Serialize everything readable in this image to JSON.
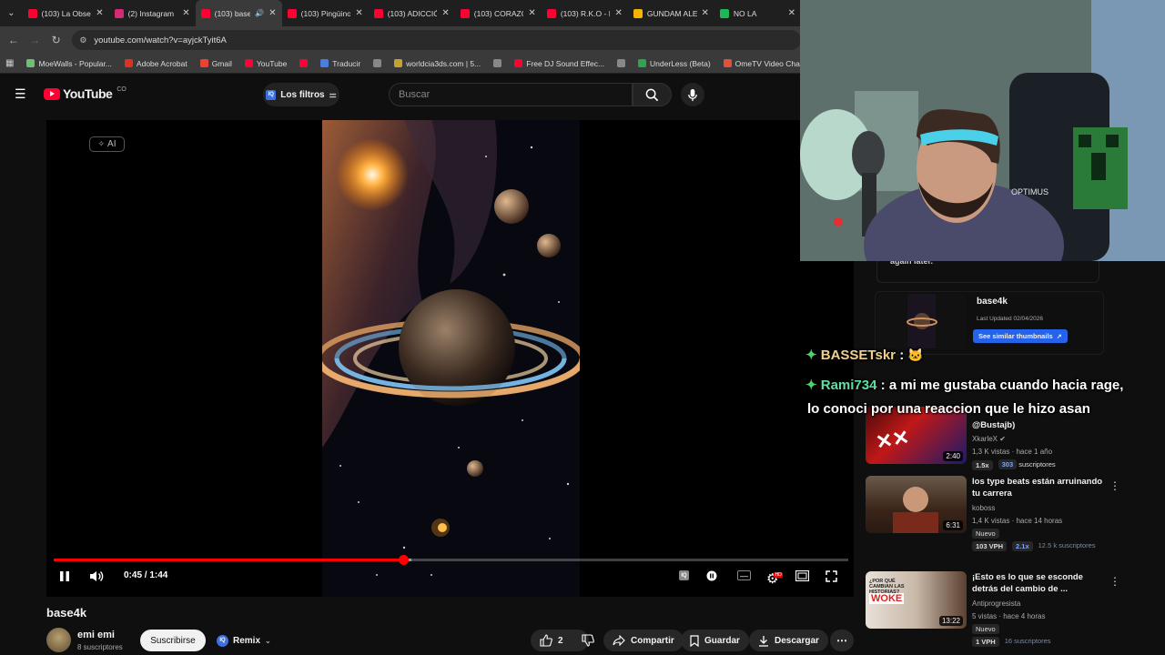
{
  "tabs": [
    {
      "title": "(103) La Obses",
      "fav": "youtube-icon",
      "color": "#ff0033"
    },
    {
      "title": "(2) Instagram",
      "fav": "instagram-icon",
      "color": "#d62976"
    },
    {
      "title": "(103) base4",
      "fav": "youtube-icon",
      "color": "#ff0033",
      "active": true
    },
    {
      "title": "(103) Pingüino",
      "fav": "youtube-icon",
      "color": "#ff0033"
    },
    {
      "title": "(103) ADICCIÓ",
      "fav": "youtube-icon",
      "color": "#ff0033"
    },
    {
      "title": "(103) CORAZÓ",
      "fav": "youtube-icon",
      "color": "#ff0033"
    },
    {
      "title": "(103) R.K.O - N",
      "fav": "youtube-icon",
      "color": "#ff0033"
    },
    {
      "title": "GUNDAM ALE",
      "fav": "drive-icon",
      "color": "#f4b400"
    },
    {
      "title": "NO LA",
      "fav": "spotify-icon",
      "color": "#1db954"
    }
  ],
  "url": "youtube.com/watch?v=ayjckTyit6A",
  "bookmarks": [
    {
      "label": "MoeWalls - Popular...",
      "color": "#6fbf73"
    },
    {
      "label": "Adobe Acrobat",
      "color": "#e0301e"
    },
    {
      "label": "Gmail",
      "color": "#ea4335"
    },
    {
      "label": "YouTube",
      "color": "#ff0033"
    },
    {
      "label": "",
      "color": "#ff0033"
    },
    {
      "label": "Traducir",
      "color": "#4a7fe0"
    },
    {
      "label": "",
      "color": "#888888"
    },
    {
      "label": "worldcia3ds.com | 5...",
      "color": "#c8a030"
    },
    {
      "label": "",
      "color": "#888888"
    },
    {
      "label": "Free DJ Sound Effec...",
      "color": "#ff0033"
    },
    {
      "label": "",
      "color": "#888888"
    },
    {
      "label": "UnderLess (Beta)",
      "color": "#2ea44f"
    },
    {
      "label": "OmeTV Video Chat...",
      "color": "#e0503a"
    }
  ],
  "yt": {
    "logo_word": "YouTube",
    "logo_country": "CO",
    "filters_label": "Los filtros",
    "search_placeholder": "Buscar"
  },
  "player": {
    "ai_badge": "AI",
    "time": "0:45 / 1:44",
    "progress": 0.44,
    "buffered": 0.45
  },
  "video": {
    "title": "base4k",
    "channel": "emi emi",
    "subscribers": "8 suscriptores",
    "subscribe_label": "Suscribirse",
    "remix_label": "Remix",
    "likes": "2",
    "share_label": "Compartir",
    "save_label": "Guardar",
    "download_label": "Descargar"
  },
  "sidebar": {
    "again_text": "again later.",
    "ext_title": "base4k",
    "ext_updated": "Last Updated 02/04/2026",
    "ext_button": "See similar thumbnails",
    "rec1": {
      "title_tail": "@Bustajb)",
      "channel": "XkarleX",
      "meta": "1,3 K vistas · hace 1 año",
      "dur": "2:40",
      "tag1": "1.5x",
      "tag2_a": "303",
      "tag2_b": "suscriptores"
    },
    "rec2": {
      "title": "los type beats están arruinando tu carrera",
      "channel": "koboss",
      "meta": "1,4 K vistas · hace 14 horas",
      "new": "Nuevo",
      "dur": "6:31",
      "tag1": "103 VPH",
      "tag2": "2.1x",
      "tag3": "12.5 k suscriptores"
    },
    "rec3": {
      "title": "¡Esto es lo que se esconde detrás del cambio de ...",
      "channel": "Antiprogresista",
      "meta": "5 vistas · hace 4 horas",
      "new": "Nuevo",
      "dur": "13:22",
      "tag1": "1 VPH",
      "tag2": "16 suscriptores",
      "thumb_text1": "¿POR QUÉ CAMBIAN LAS HISTORIAS?",
      "thumb_text2": "WOKE"
    }
  },
  "chat": [
    {
      "user": "BASSETskr",
      "sep": ":",
      "msg": "",
      "user_color": "#f2d08a"
    },
    {
      "user": "Rami734",
      "sep": ":",
      "msg": "a mi me gustaba cuando hacia rage,",
      "user_color": "#5ee0a0"
    },
    {
      "user": "",
      "sep": "",
      "msg": "lo conoci por una reaccion que le hizo asan",
      "user_color": "#ffffff"
    }
  ],
  "webcam_text": "OPTIMUS",
  "colors": {
    "accent": "#ff0033",
    "bg": "#0f0f0f"
  }
}
